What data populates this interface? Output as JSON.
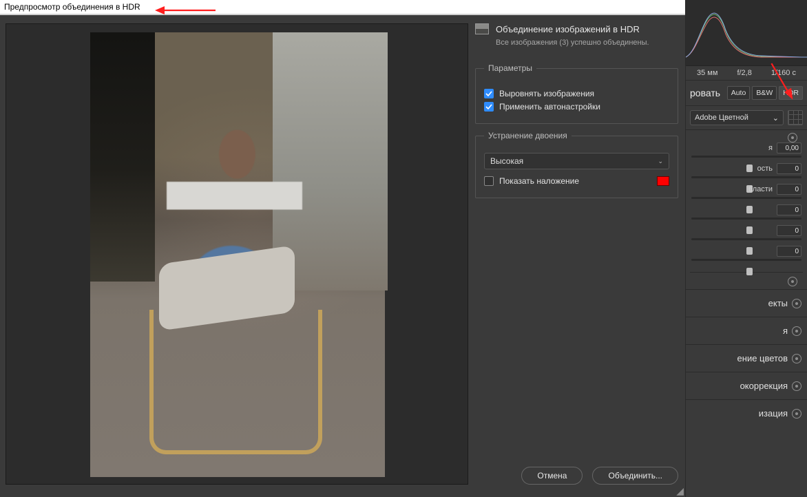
{
  "titlebar": {
    "title": "Предпросмотр объединения в HDR"
  },
  "dialog": {
    "header": {
      "title": "Объединение изображений в HDR",
      "subtitle": "Все изображения (3) успешно объединены."
    },
    "parameters": {
      "legend": "Параметры",
      "align_images": {
        "label": "Выровнять изображения",
        "checked": true
      },
      "auto_settings": {
        "label": "Применить автонастройки",
        "checked": true
      }
    },
    "deghost": {
      "legend": "Устранение двоения",
      "amount": {
        "selected": "Высокая"
      },
      "show_overlay": {
        "label": "Показать наложение",
        "checked": false
      },
      "overlay_color": "#ff0000"
    },
    "buttons": {
      "cancel": "Отмена",
      "merge": "Объединить..."
    }
  },
  "panel": {
    "metadata": {
      "focal_length": "35 мм",
      "aperture": "f/2,8",
      "shutter": "1/160 с"
    },
    "mode_buttons": {
      "edit": "ровать",
      "auto": "Auto",
      "bw": "B&W",
      "hdr": "HDR"
    },
    "profile": {
      "selected": "Adobe Цветной"
    },
    "sliders": [
      {
        "label": "я",
        "value": "0,00",
        "pos": 50
      },
      {
        "label": "ость",
        "value": "0",
        "pos": 50
      },
      {
        "label": "бласти",
        "value": "0",
        "pos": 50
      },
      {
        "label": "",
        "value": "0",
        "pos": 50
      },
      {
        "label": "",
        "value": "0",
        "pos": 50
      },
      {
        "label": "",
        "value": "0",
        "pos": 50
      }
    ],
    "sections": [
      "екты",
      "я",
      "ение цветов",
      "окоррекция",
      "изация"
    ]
  }
}
